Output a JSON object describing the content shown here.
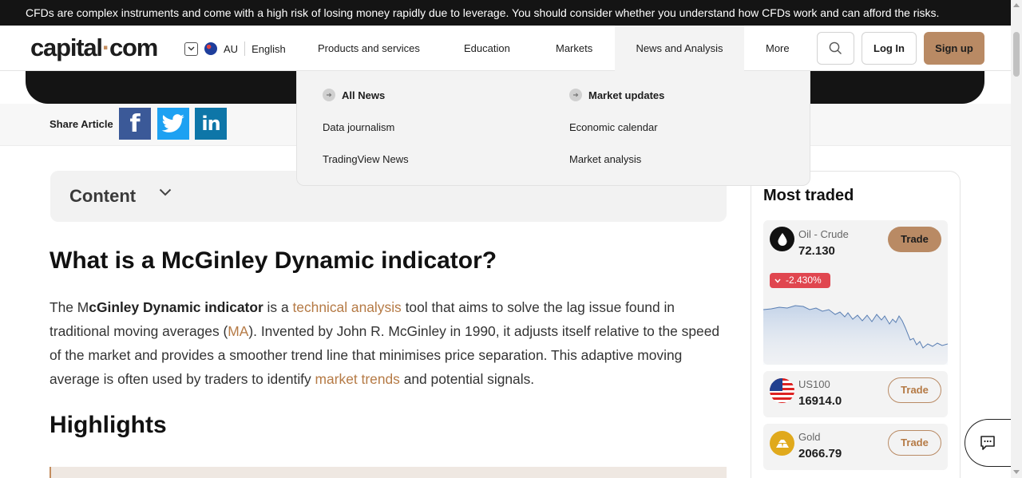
{
  "risk_banner": "CFDs are complex instruments and come with a high risk of losing money rapidly due to leverage. You should consider whether you understand how CFDs work and can afford the risks.",
  "header": {
    "logo_left": "capital",
    "logo_dot": "·",
    "logo_right": "com",
    "region_code": "AU",
    "language": "English",
    "nav": [
      "Products and services",
      "Education",
      "Markets",
      "News and Analysis",
      "More"
    ],
    "active_nav": "News and Analysis",
    "login_label": "Log In",
    "signup_label": "Sign up"
  },
  "dropdown": {
    "col1": [
      "All News",
      "Data journalism",
      "TradingView News"
    ],
    "col2": [
      "Market updates",
      "Economic calendar",
      "Market analysis"
    ]
  },
  "share": {
    "label": "Share Article",
    "fb": "f",
    "li": "in"
  },
  "content_toggle": {
    "label": "Content"
  },
  "article": {
    "title": "What is a McGinley Dynamic indicator?",
    "p1_start": "The M",
    "p1_bold": "cGinley Dynamic indicator",
    "p1_mid1": " is a ",
    "link1": "technical analysis",
    "p1_mid2": " tool that aims to solve the lag issue found in traditional moving averages (",
    "link2": "MA",
    "p1_mid3": "). Invented by John R. McGinley in 1990, it adjusts itself relative to the speed of the market and provides a smoother trend line that minimises price separation. This adaptive moving average is often used by traders to identify ",
    "link3": "market trends",
    "p1_end": " and potential signals.",
    "highlights": "Highlights"
  },
  "most_traded": {
    "title": "Most traded",
    "items": [
      {
        "name": "Oil - Crude",
        "price": "72.130",
        "change": "-2.430%",
        "trade_label": "Trade",
        "icon": "oil-drop-icon"
      },
      {
        "name": "US100",
        "price": "16914.0",
        "trade_label": "Trade",
        "icon": "us-flag-icon"
      },
      {
        "name": "Gold",
        "price": "2066.79",
        "trade_label": "Trade",
        "icon": "gold-bars-icon"
      }
    ]
  },
  "colors": {
    "accent": "#b98a64",
    "link": "#b57a45",
    "negative": "#e0464f",
    "dark": "#141414"
  }
}
